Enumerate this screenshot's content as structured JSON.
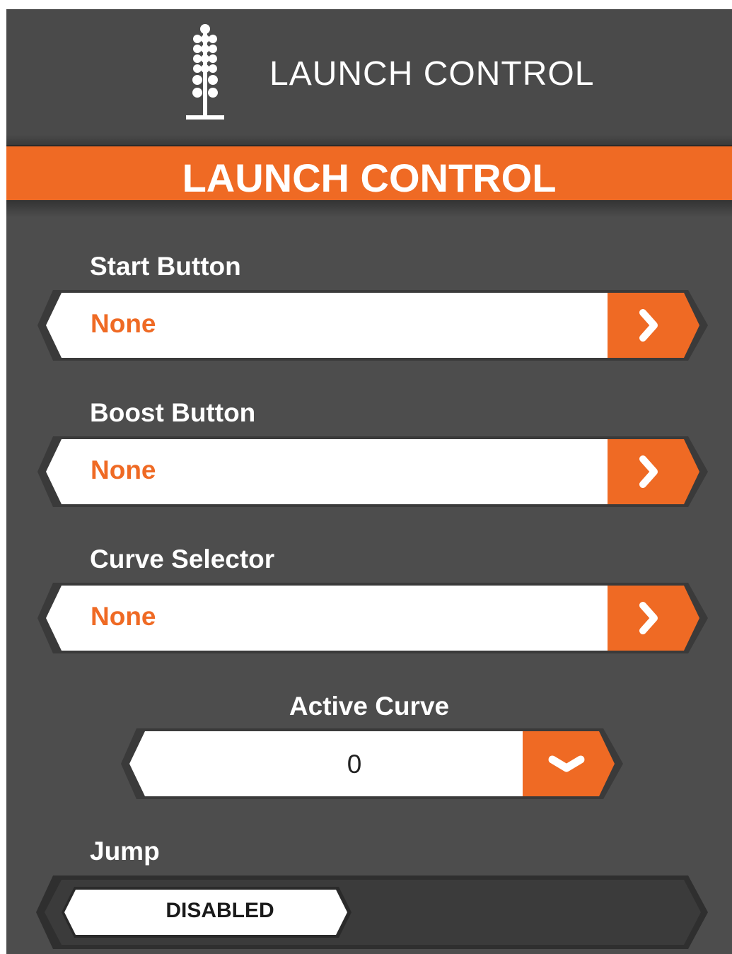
{
  "header": {
    "title": "LAUNCH CONTROL",
    "icon": "christmas-tree-light-icon"
  },
  "title_bar": {
    "label": "LAUNCH CONTROL"
  },
  "fields": {
    "start_button": {
      "label": "Start Button",
      "value": "None",
      "arrow_icon": "chevron-right-icon"
    },
    "boost_button": {
      "label": "Boost Button",
      "value": "None",
      "arrow_icon": "chevron-right-icon"
    },
    "curve_selector": {
      "label": "Curve Selector",
      "value": "None",
      "arrow_icon": "chevron-right-icon"
    }
  },
  "active_curve": {
    "label": "Active Curve",
    "value": "0",
    "arrow_icon": "chevron-down-icon"
  },
  "jump": {
    "label": "Jump",
    "state": "DISABLED"
  },
  "colors": {
    "accent": "#ef6a24",
    "background": "#4d4d4d",
    "text_light": "#ffffff",
    "field_bg": "#ffffff"
  }
}
